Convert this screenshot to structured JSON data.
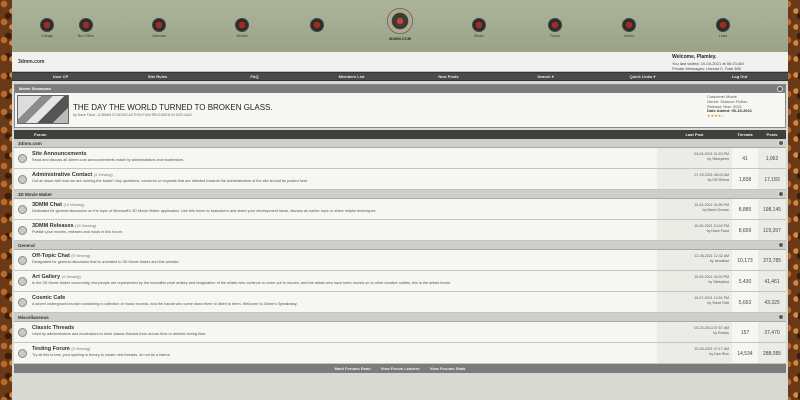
{
  "header": {
    "nav_left": [
      "Collage",
      "Box Office",
      "Calendar",
      "Movies"
    ],
    "logo_label": "3DMM.COM",
    "nav_right": [
      "Studio",
      "Forum",
      "Actors",
      "Links"
    ]
  },
  "sitebar": {
    "site_name": "3dmm.com",
    "welcome_title": "Welcome, Plamley.",
    "welcome_line1": "You last visited: 10-04-2021 at 06:23 AM",
    "welcome_line2": "Private Messages: Unread 0, Total 385"
  },
  "menu": [
    "User CP",
    "Site Rules",
    "FAQ",
    "Members List",
    "New Posts",
    "Search ▾",
    "Quick Links ▾",
    "Log Out"
  ],
  "showcase": {
    "header": "Movie Showcase",
    "title": "THE DAY THE WORLD TURNED TO BROKEN GLASS.",
    "subtitle": "by Dave Faud - A 3DMM STUDIOS ACTION FILM RELEASED IN 2021 AUG",
    "info_line1": "Cutscene/ Movie",
    "info_line2": "Genre: Science Fiction",
    "info_line3": "Release Year: 2021",
    "info_line4": "Date Added: 06-15-2021",
    "rating": "★★★★☆"
  },
  "table": {
    "col_forum": "Forum",
    "col_last": "Last Post",
    "col_threads": "Threads",
    "col_posts": "Posts"
  },
  "categories": [
    {
      "name": "3dmm.com",
      "forums": [
        {
          "name": "Site Announcements",
          "viewing": "",
          "desc": "Read and discuss all 3dmm.com announcements made by administrators and moderators.",
          "last_date": "04-03-2021 01:53 PM",
          "last_by": "by Stinkyteen",
          "threads": "41",
          "posts": "1,062"
        },
        {
          "name": "Administrative Contact",
          "viewing": "(4 Viewing)",
          "desc": "Got an issue with how we are running the board? Any questions, concerns or requests that are directed towards the Administrators of the site should be posted here.",
          "last_date": "07-29-2021 08:43 AM",
          "last_by": "by GB Rivera",
          "threads": "1,838",
          "posts": "17,183"
        }
      ]
    },
    {
      "name": "3D Movie Maker",
      "forums": [
        {
          "name": "3DMM Chat",
          "viewing": "(15 Viewing)",
          "desc": "Dedicated for general discussion on the topic of Microsoft's 3D Movie Maker application. Use this forum to brainstorm and share your development ideas, discuss an earlier topic or share helpful techniques.",
          "last_date": "10-04-2021 01:55 PM",
          "last_by": "by Mario Grosse",
          "threads": "8,885",
          "posts": "198,145"
        },
        {
          "name": "3DMM Releases",
          "viewing": "(15 Viewing)",
          "desc": "Publish your movies, releases and mods in this forum.",
          "last_date": "10-05-2021 10:03 PM",
          "last_by": "by Dave Faud",
          "threads": "8,659",
          "posts": "119,397"
        }
      ]
    },
    {
      "name": "General",
      "forums": [
        {
          "name": "Off-Topic Chat",
          "viewing": "(5 Viewing)",
          "desc": "Designated for general discussion that is unrelated to 3D Movie Maker and this website.",
          "last_date": "12-08-2021 12:42 AM",
          "last_by": "by Iamdewz",
          "threads": "10,173",
          "posts": "373,785"
        },
        {
          "name": "Art Gallery",
          "viewing": "(4 Viewing)",
          "desc": "In the 3D Movie Maker community, few people are represented by the incredible pixel artistry and imagination of the artists who continue to come out to movies, and the artists who have been moved on to other creative outlets, this is the artists forum.",
          "last_date": "10-09-2021 04:33 PM",
          "last_by": "by Stinkyfoot",
          "threads": "5,430",
          "posts": "41,461"
        },
        {
          "name": "Cosmic Cafe",
          "viewing": "",
          "desc": "A secret underground bunker containing a collection of music records, and the hands who come down there to listen to them. Welcome to 3dmm's Speakeasy.",
          "last_date": "10-07-2021 12:51 PM",
          "last_by": "by Steve Raft",
          "threads": "5,653",
          "posts": "43,325"
        }
      ]
    },
    {
      "name": "Miscellaneous",
      "forums": [
        {
          "name": "Classic Threads",
          "viewing": "",
          "desc": "Used by administrators and moderators to store classic threads from across time or deleted during time.",
          "last_date": "03-23-2014 07:57 AM",
          "last_by": "by Rowdy",
          "threads": "157",
          "posts": "37,470"
        },
        {
          "name": "Testing Forum",
          "viewing": "(9 Viewing)",
          "desc": "Try all this to test, your spelling in theory to create new threads, do not be a blame.",
          "last_date": "10-05-2021 07:17 AM",
          "last_by": "by Dan Rice",
          "threads": "14,534",
          "posts": "288,085"
        }
      ]
    }
  ],
  "footer": [
    "Mark Forums Read",
    "View Forum Leaders",
    "View Forums Stats"
  ]
}
